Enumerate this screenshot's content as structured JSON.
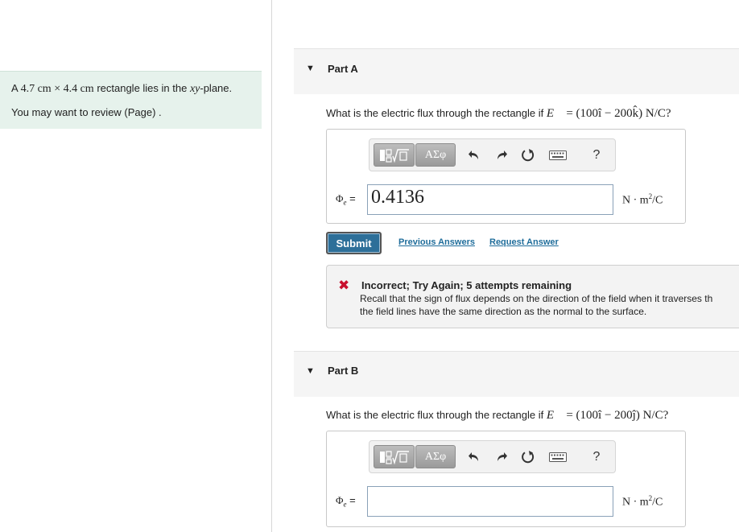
{
  "intro": {
    "line1_prefix": "A ",
    "dim1": "4.7 cm",
    "times": " × ",
    "dim2": "4.4 cm",
    "line1_middle": " rectangle lies in the ",
    "plane": "xy",
    "line1_suffix": "-plane.",
    "line2": "You may want to review (Page) ."
  },
  "partA": {
    "label": "Part A",
    "question_prefix": "What is the electric flux through the rectangle if ",
    "field_expr": "= (100î − 200k̂) N/C?",
    "toolbar": {
      "templates_icon": "template-sqrt-icon",
      "greek_label": "ΑΣφ",
      "help_label": "?"
    },
    "phi_label": "Φ",
    "phi_sub": "e",
    "equals": "=",
    "input_value": "0.4136",
    "units_prefix": "N · m",
    "units_exp": "2",
    "units_suffix": "/C",
    "submit_label": "Submit",
    "previous_answers_label": "Previous Answers",
    "request_answer_label": "Request Answer",
    "feedback": {
      "title": "Incorrect; Try Again; 5 attempts remaining",
      "line1": "Recall that the sign of flux depends on the direction of the field when it traverses th",
      "line2": "the field lines have the same direction as the normal to the surface.",
      "status_color": "#c8102e"
    }
  },
  "partB": {
    "label": "Part B",
    "question_prefix": "What is the electric flux through the rectangle if ",
    "field_expr": "= (100î − 200ĵ) N/C?",
    "toolbar": {
      "greek_label": "ΑΣφ",
      "help_label": "?"
    },
    "phi_label": "Φ",
    "phi_sub": "e",
    "equals": "=",
    "input_value": "",
    "units_prefix": "N · m",
    "units_exp": "2",
    "units_suffix": "/C"
  },
  "colors": {
    "intro_bg": "#e6f2ec",
    "submit_bg": "#2d6f99",
    "link": "#1f6d9b"
  }
}
